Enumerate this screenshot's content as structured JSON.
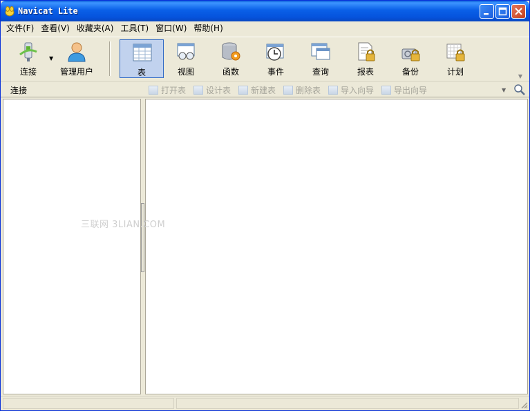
{
  "window": {
    "title": "Navicat Lite"
  },
  "menu": [
    {
      "label": "文件(F)"
    },
    {
      "label": "查看(V)"
    },
    {
      "label": "收藏夹(A)"
    },
    {
      "label": "工具(T)"
    },
    {
      "label": "窗口(W)"
    },
    {
      "label": "帮助(H)"
    }
  ],
  "toolbar": {
    "connect": "连接",
    "manage_users": "管理用户",
    "tables": "表",
    "views": "视图",
    "functions": "函数",
    "events": "事件",
    "queries": "查询",
    "reports": "报表",
    "backup": "备份",
    "schedule": "计划",
    "active": "表"
  },
  "object_bar": {
    "section_label": "连接",
    "open_table": "打开表",
    "design_table": "设计表",
    "new_table": "新建表",
    "delete_table": "删除表",
    "import_wizard": "导入向导",
    "export_wizard": "导出向导"
  },
  "watermark": "三联网 3LIAN.COM",
  "colors": {
    "title_bar": "#0A60E8",
    "active_tool": "#C1D2EE",
    "disabled_text": "#A7A69C"
  }
}
